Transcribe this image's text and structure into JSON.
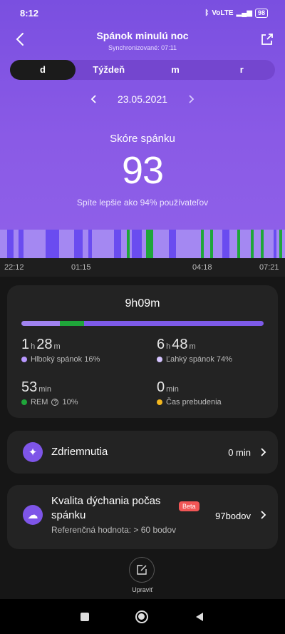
{
  "status": {
    "time": "8:12",
    "battery": "98",
    "network": "VoLTE"
  },
  "header": {
    "title": "Spánok minulú noc",
    "subtitle": "Synchronizované: 07:11"
  },
  "tabs": [
    {
      "label": "d",
      "active": true
    },
    {
      "label": "Týždeň",
      "active": false
    },
    {
      "label": "m",
      "active": false
    },
    {
      "label": "r",
      "active": false
    }
  ],
  "date": "23.05.2021",
  "score": {
    "label": "Skóre spánku",
    "value": "93",
    "description": "Spíte lepšie ako 94% používateľov"
  },
  "timeline": {
    "labels": [
      "22:12",
      "01:15",
      "04:18",
      "07:21"
    ],
    "colors": {
      "light": "#a488f2",
      "deep": "#6a4cf0",
      "rem": "#1fa63a"
    }
  },
  "summary": {
    "total": "9h09m",
    "bar": [
      {
        "name": "Hlboký",
        "fraction": 0.16,
        "color": "#a083f0"
      },
      {
        "name": "REM",
        "fraction": 0.1,
        "color": "#1fa63a"
      },
      {
        "name": "Ľahký",
        "fraction": 0.74,
        "color": "#7d5ae8"
      }
    ],
    "deep": {
      "h": "1",
      "h_unit": "h",
      "m": "28",
      "m_unit": "m",
      "label": "Hlboký spánok 16%",
      "color": "#b898ff"
    },
    "light": {
      "h": "6",
      "h_unit": "h",
      "m": "48",
      "m_unit": "m",
      "label": "Ľahký spánok 74%",
      "color": "#d5c4ff"
    },
    "rem": {
      "v": "53",
      "unit": "min",
      "label": "REM",
      "pct": "10%",
      "color": "#1fa63a"
    },
    "awake": {
      "v": "0",
      "unit": "min",
      "label": "Čas prebudenia",
      "color": "#f3b71e"
    }
  },
  "nap": {
    "title": "Zdriemnutia",
    "value": "0 min"
  },
  "breathing": {
    "title_line1": "Kvalita dýchania počas",
    "title_line2": "spánku",
    "badge": "Beta",
    "value": "97bodov",
    "reference": "Referenčná hodnota: > 60 bodov"
  },
  "edit": {
    "label": "Upraviť"
  }
}
